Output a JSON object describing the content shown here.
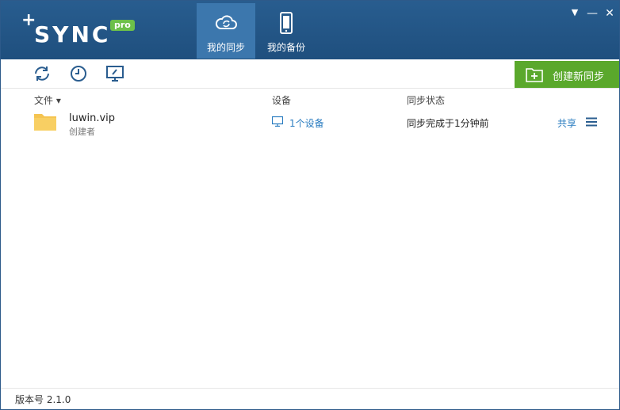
{
  "app": {
    "logo_text": "SYNC",
    "logo_plus": "+",
    "logo_badge": "pro"
  },
  "nav": {
    "tabs": [
      {
        "label": "我的同步",
        "icon": "cloud-sync-icon",
        "active": true
      },
      {
        "label": "我的备份",
        "icon": "phone-icon",
        "active": false
      }
    ]
  },
  "window_controls": {
    "dropdown": "▼",
    "minimize": "—",
    "close": "✕"
  },
  "toolbar": {
    "icons": [
      "sync-icon",
      "clock-icon",
      "monitor-icon"
    ],
    "create_label": "创建新同步"
  },
  "columns": {
    "file": "文件 ▾",
    "device": "设备",
    "status": "同步状态"
  },
  "rows": [
    {
      "name": "luwin.vip",
      "role": "创建者",
      "device": "1个设备",
      "status": "同步完成于1分钟前",
      "share": "共享"
    }
  ],
  "footer": {
    "version": "版本号 2.1.0"
  },
  "colors": {
    "titlebar": "#1f4f7e",
    "active_tab": "#3c77ad",
    "create_button": "#5aa82c",
    "link": "#2a7cc0",
    "folder": "#f5c451"
  }
}
